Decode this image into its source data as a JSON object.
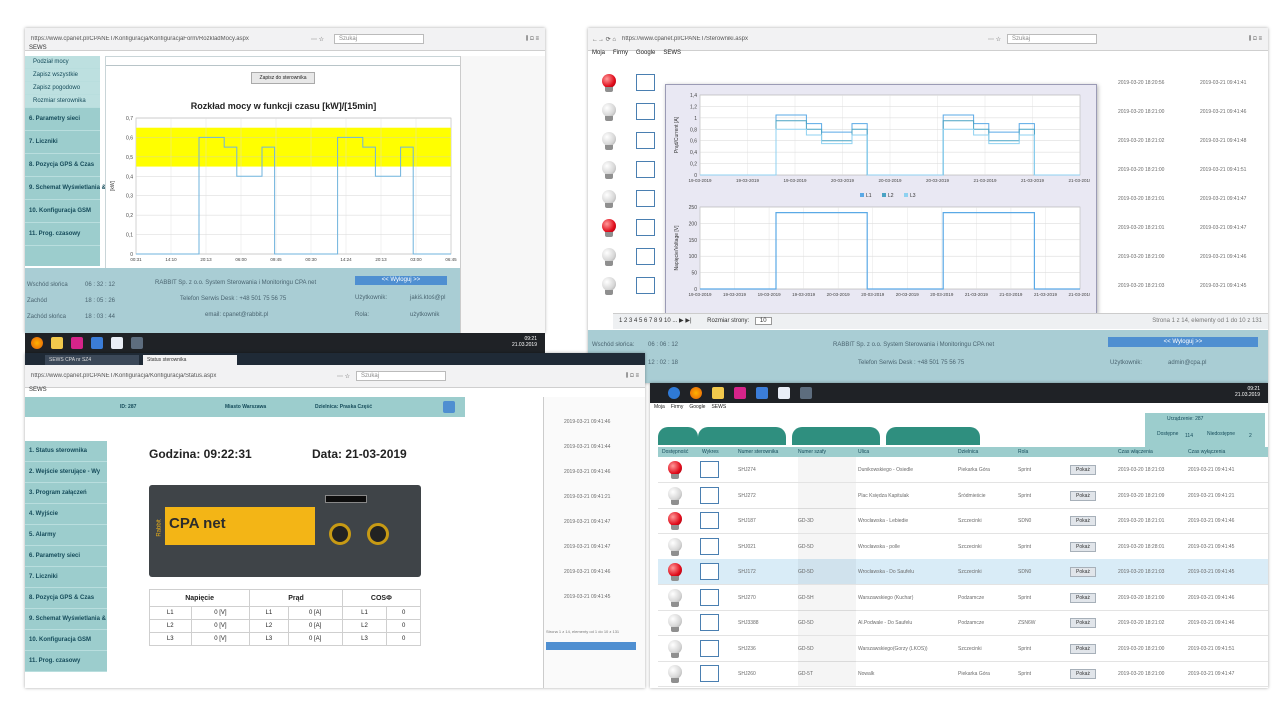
{
  "top_left_window": {
    "url": "https://www.cpanet.pl/CPANET/Konfiguracja/KonfiguracjaForm/RozkladMocy.aspx",
    "search_placeholder": "Szukaj",
    "tab_title": "SEWS",
    "menu_subitems": [
      "Podział mocy",
      "Zapisz wszystkie",
      "Zapisz pogodowo",
      "Rozmiar sterownika"
    ],
    "menu_items": [
      "6. Parametry sieci",
      "7. Liczniki",
      "8. Pozycja GPS & Czas",
      "9. Schemat Wyświetlania & Buttony",
      "10. Konfiguracja GSM",
      "11. Prog. czasowy"
    ],
    "save_button": "Zapisz do sterownika",
    "chart_title": "Rozkład mocy w funkcji czasu [kW]/[15min]",
    "footer": {
      "label1": "Wschód słońca",
      "val1": "06 : 32 : 12",
      "label2": "Zachód",
      "val2": "18 : 05 : 26",
      "label3": "Zachód słońca",
      "val3": "18 : 03 : 44",
      "company": "RABBIT Sp. z o.o. System Sterowania i Monitoringu CPA net",
      "phone": "Telefon Serwis Desk : +48 501 75 56 75",
      "email": "email: cpanet@rabbit.pl",
      "logout": "<< Wyloguj >>",
      "user_label1": "Użytkownik:",
      "user_val1": "jakiś.ktoś@pl",
      "user_label2": "Rola:",
      "user_val2": "użytkownik"
    }
  },
  "chart_data": [
    {
      "type": "area",
      "title": "Rozkład mocy w funkcji czasu [kW]/[15min]",
      "ylabel": "[kW]",
      "ylim": [
        0,
        0.7
      ],
      "y_ticks": [
        "0,7",
        "0,6",
        "0,5",
        "0,4",
        "0,3",
        "0,2",
        "0,1",
        "0"
      ],
      "x_ticks": [
        "00:31",
        "14:10",
        "20:13",
        "06:00",
        "09:45",
        "00:30",
        "14:24",
        "20:13",
        "03:00",
        "06:45"
      ],
      "yellow_band": [
        0.45,
        0.65
      ],
      "series": [
        {
          "values": [
            0,
            0,
            0,
            0,
            0,
            0.6,
            0.6,
            0.55,
            0.4,
            0.4,
            0.55,
            0,
            0,
            0,
            0,
            0,
            0.6,
            0.6,
            0.55,
            0.4,
            0.4,
            0.55,
            0,
            0,
            0
          ]
        }
      ]
    },
    {
      "type": "line",
      "ylabel": "Prąd/Current [A]",
      "ylim": [
        0,
        1.4
      ],
      "y_ticks": [
        "1,4",
        "1,2",
        "1",
        "0,8",
        "0,6",
        "0,4",
        "0,2",
        "0"
      ],
      "x_ticks": [
        "19-03-2019",
        "19-03-2019",
        "19-03-2019",
        "20-03-2019",
        "20-03-2019",
        "20-03-2019",
        "21-03-2019",
        "21-03-2019",
        "21-03-2019"
      ],
      "legend": [
        "L1",
        "L2",
        "L3"
      ],
      "series": [
        {
          "name": "L1",
          "values": [
            0,
            0,
            0,
            0,
            0,
            1.05,
            1.05,
            0.9,
            0.75,
            0.75,
            0.9,
            0,
            0,
            0,
            0,
            0,
            1.05,
            1.05,
            0.9,
            0.75,
            0.75,
            0.9,
            0,
            0,
            0
          ]
        },
        {
          "name": "L2",
          "values": [
            0,
            0,
            0,
            0,
            0,
            0.95,
            0.95,
            0.8,
            0.6,
            0.6,
            0.8,
            0,
            0,
            0,
            0,
            0,
            0.95,
            0.95,
            0.8,
            0.6,
            0.6,
            0.8,
            0,
            0,
            0
          ]
        },
        {
          "name": "L3",
          "values": [
            0,
            0,
            0,
            0,
            0,
            0.8,
            0.8,
            0.7,
            0.55,
            0.55,
            0.7,
            0,
            0,
            0,
            0,
            0,
            0.8,
            0.8,
            0.7,
            0.55,
            0.55,
            0.7,
            0,
            0,
            0
          ]
        }
      ]
    },
    {
      "type": "line",
      "ylabel": "Napięcie/Voltage [V]",
      "ylim": [
        0,
        250
      ],
      "y_ticks": [
        "250",
        "200",
        "150",
        "100",
        "50",
        "0"
      ],
      "x_ticks": [
        "19-03-2019",
        "19-03-2019",
        "19-03-2019",
        "19-03-2019",
        "20-03-2019",
        "20-03-2019",
        "20-03-2019",
        "20-03-2019",
        "21-03-2019",
        "21-03-2019",
        "21-03-2019",
        "21-03-2019"
      ],
      "legend": [
        "L1",
        "L2",
        "L3"
      ],
      "series": [
        {
          "name": "L1",
          "values": [
            0,
            0,
            0,
            0,
            0,
            233,
            233,
            233,
            233,
            233,
            233,
            0,
            0,
            0,
            0,
            0,
            233,
            233,
            233,
            233,
            233,
            233,
            0,
            0,
            0
          ]
        }
      ]
    }
  ],
  "top_right_window": {
    "url": "https://www.cpanet.pl/CPANET/Sterowniki.aspx",
    "search_placeholder": "Szukaj",
    "bookmarks": [
      "Moja",
      "Firmy",
      "Google",
      "SEWS"
    ],
    "timestamps": [
      "2019-03-20 18:20:56",
      "2019-03-21 09:41:41",
      "2019-03-20 18:21:00",
      "2019-03-21 09:41:46",
      "2019-03-20 18:21:02",
      "2019-03-21 09:41:48",
      "2019-03-20 18:21:00",
      "2019-03-21 09:41:51",
      "2019-03-20 18:21:01",
      "2019-03-21 09:41:47",
      "2019-03-20 18:21:01",
      "2019-03-21 09:41:47",
      "2019-03-20 18:21:00",
      "2019-03-21 09:41:46",
      "2019-03-20 18:21:03",
      "2019-03-21 09:41:45"
    ],
    "pager": "1 2 3 4 5 6 7 8 9 10 ... ▶ ▶|",
    "page_size_label": "Rozmiar strony:",
    "page_size_value": "10",
    "page_info": "Strona 1 z 14, elementy od 1 do 10 z 131",
    "footer": {
      "label1": "Wschód słońca:",
      "val1": "06 : 06 : 12",
      "val2": "12 : 02 : 18",
      "company": "RABBIT Sp. z o.o. System Sterowania i Monitoringu CPA net",
      "phone": "Telefon Serwis Desk : +48 501 75 56 75",
      "logout": "<< Wyloguj >>",
      "user_label": "Użytkownik:",
      "user_val": "admin@cpa.pl"
    },
    "clock": {
      "time": "09:21",
      "date": "21.03.2019"
    }
  },
  "middle_taskbar": {
    "tab1": "SEWS CPA nr SZ4",
    "tab2": "Status sterownika",
    "clock_time": "09:21",
    "clock_date": "21.03.2019"
  },
  "bottom_left_window": {
    "url": "https://www.cpanet.pl/CPANET/Konfiguracja/Konfiguracja/Status.aspx",
    "search_placeholder": "Szukaj",
    "tab_title": "SEWS",
    "id_label": "ID: 287",
    "location": "Miasto Warszawa",
    "district": "Dzielnica: Praska Część",
    "menu_items": [
      "1. Status sterownika",
      "2. Wejście sterujące - Wy",
      "3. Program załączeń",
      "4. Wyjście",
      "5. Alarmy",
      "6. Parametry sieci",
      "7. Liczniki",
      "8. Pozycja GPS & Czas",
      "9. Schemat Wyświetlania & Buttony",
      "10. Konfiguracja GSM",
      "11. Prog. czasowy"
    ],
    "clock_label": "Godzina: 09:22:31",
    "date_label": "Data: 21-03-2019",
    "device_brand": "CPA net",
    "device_side": "Rabbit",
    "table": {
      "headers": [
        "Napięcie",
        "Prąd",
        "COSΦ"
      ],
      "rows": [
        [
          "L1",
          "0 [V]",
          "L1",
          "0 [A]",
          "L1",
          "0"
        ],
        [
          "L2",
          "0 [V]",
          "L2",
          "0 [A]",
          "L2",
          "0"
        ],
        [
          "L3",
          "0 [V]",
          "L3",
          "0 [A]",
          "L3",
          "0"
        ]
      ]
    },
    "right_timestamps": [
      "2019-03-21 09:41:46",
      "2019-03-21 09:41:44",
      "2019-03-21 09:41:46",
      "2019-03-21 09:41:21",
      "2019-03-21 09:41:47",
      "2019-03-21 09:41:47",
      "2019-03-21 09:41:46",
      "2019-03-21 09:41:45"
    ],
    "right_footer": "Strona 1 z 14, elementy od 1 do 10 z 131"
  },
  "bottom_right_window": {
    "toolbar_time": "09:21",
    "toolbar_date": "21.03.2019",
    "bookmarks": [
      "Moja",
      "Firmy",
      "Google",
      "SEWS"
    ],
    "header_title": "Urządzenie: 287",
    "header_sub1": "Dostępne",
    "header_sub1_val": "114",
    "header_sub2": "Niedostępne",
    "header_sub2_val": "2",
    "columns": [
      "Dostępność",
      "Wykres",
      "Numer sterownika",
      "Numer szafy",
      "Ulica",
      "Dzielnica",
      "Rola",
      "",
      "Czas włączenia",
      "Czas wyłączenia"
    ],
    "rows": [
      {
        "status": "on",
        "num": "SHJ274",
        "box": "",
        "street": "Dunikowskiego - Osiedle",
        "district": "Piekarka Góra",
        "role": "Sprint",
        "btn": "Pokaż",
        "t1": "2019-03-20 18:21:03",
        "t2": "2019-03-21 09:41:41"
      },
      {
        "status": "off",
        "num": "SHJ272",
        "box": "",
        "street": "Plac Księdza Kapitulak",
        "district": "Śródmieście",
        "role": "Sprint",
        "btn": "Pokaż",
        "t1": "2019-03-20 18:21:09",
        "t2": "2019-03-21 09:41:21"
      },
      {
        "status": "on",
        "num": "SHJ187",
        "box": "GD-3D",
        "street": "Wrocławska - Lebiedie",
        "district": "Szczecinki",
        "role": "SDN0",
        "btn": "Pokaż",
        "t1": "2019-03-20 18:21:01",
        "t2": "2019-03-21 09:41:46"
      },
      {
        "status": "off",
        "num": "SHJ021",
        "box": "GD-5D",
        "street": "Wrocławska - polle",
        "district": "Szczecinki",
        "role": "Sprint",
        "btn": "Pokaż",
        "t1": "2019-03-20 18:28:01",
        "t2": "2019-03-21 09:41:45"
      },
      {
        "status": "on",
        "num": "SHJ172",
        "box": "GD-5D",
        "street": "Wrocławska - Do Saufelu",
        "district": "Szczecinki",
        "role": "SDN0",
        "btn": "Pokaż",
        "t1": "2019-03-20 18:21:03",
        "t2": "2019-03-21 09:41:45"
      },
      {
        "status": "off",
        "num": "SHJ270",
        "box": "GD-5H",
        "street": "Warszawskiego (Kuchar)",
        "district": "Podzamcze",
        "role": "Sprint",
        "btn": "Pokaż",
        "t1": "2019-03-20 18:21:00",
        "t2": "2019-03-21 09:41:46"
      },
      {
        "status": "off",
        "num": "SHJ3388",
        "box": "GD-5D",
        "street": "Al.Podwale - Do Saufelu",
        "district": "Podzamcze",
        "role": "ZSN6W",
        "btn": "Pokaż",
        "t1": "2019-03-20 18:21:02",
        "t2": "2019-03-21 09:41:46"
      },
      {
        "status": "off",
        "num": "SHJ236",
        "box": "GD-5D",
        "street": "Warszawskiego(Gorzy (LKOS))",
        "district": "Szczecinki",
        "role": "Sprint",
        "btn": "Pokaż",
        "t1": "2019-03-20 18:21:00",
        "t2": "2019-03-21 09:41:51"
      },
      {
        "status": "off",
        "num": "SHJ260",
        "box": "GD-5T",
        "street": "Nowalk",
        "district": "Piekarka Góra",
        "role": "Sprint",
        "btn": "Pokaż",
        "t1": "2019-03-20 18:21:00",
        "t2": "2019-03-21 09:41:47"
      }
    ]
  },
  "colors": {
    "teal": "#9ccdcd",
    "yellow": "#ffff00",
    "series_blue": "#5aa9e6",
    "dark_taskbar": "#1f2226",
    "red_bulb": "#e00b1a"
  }
}
